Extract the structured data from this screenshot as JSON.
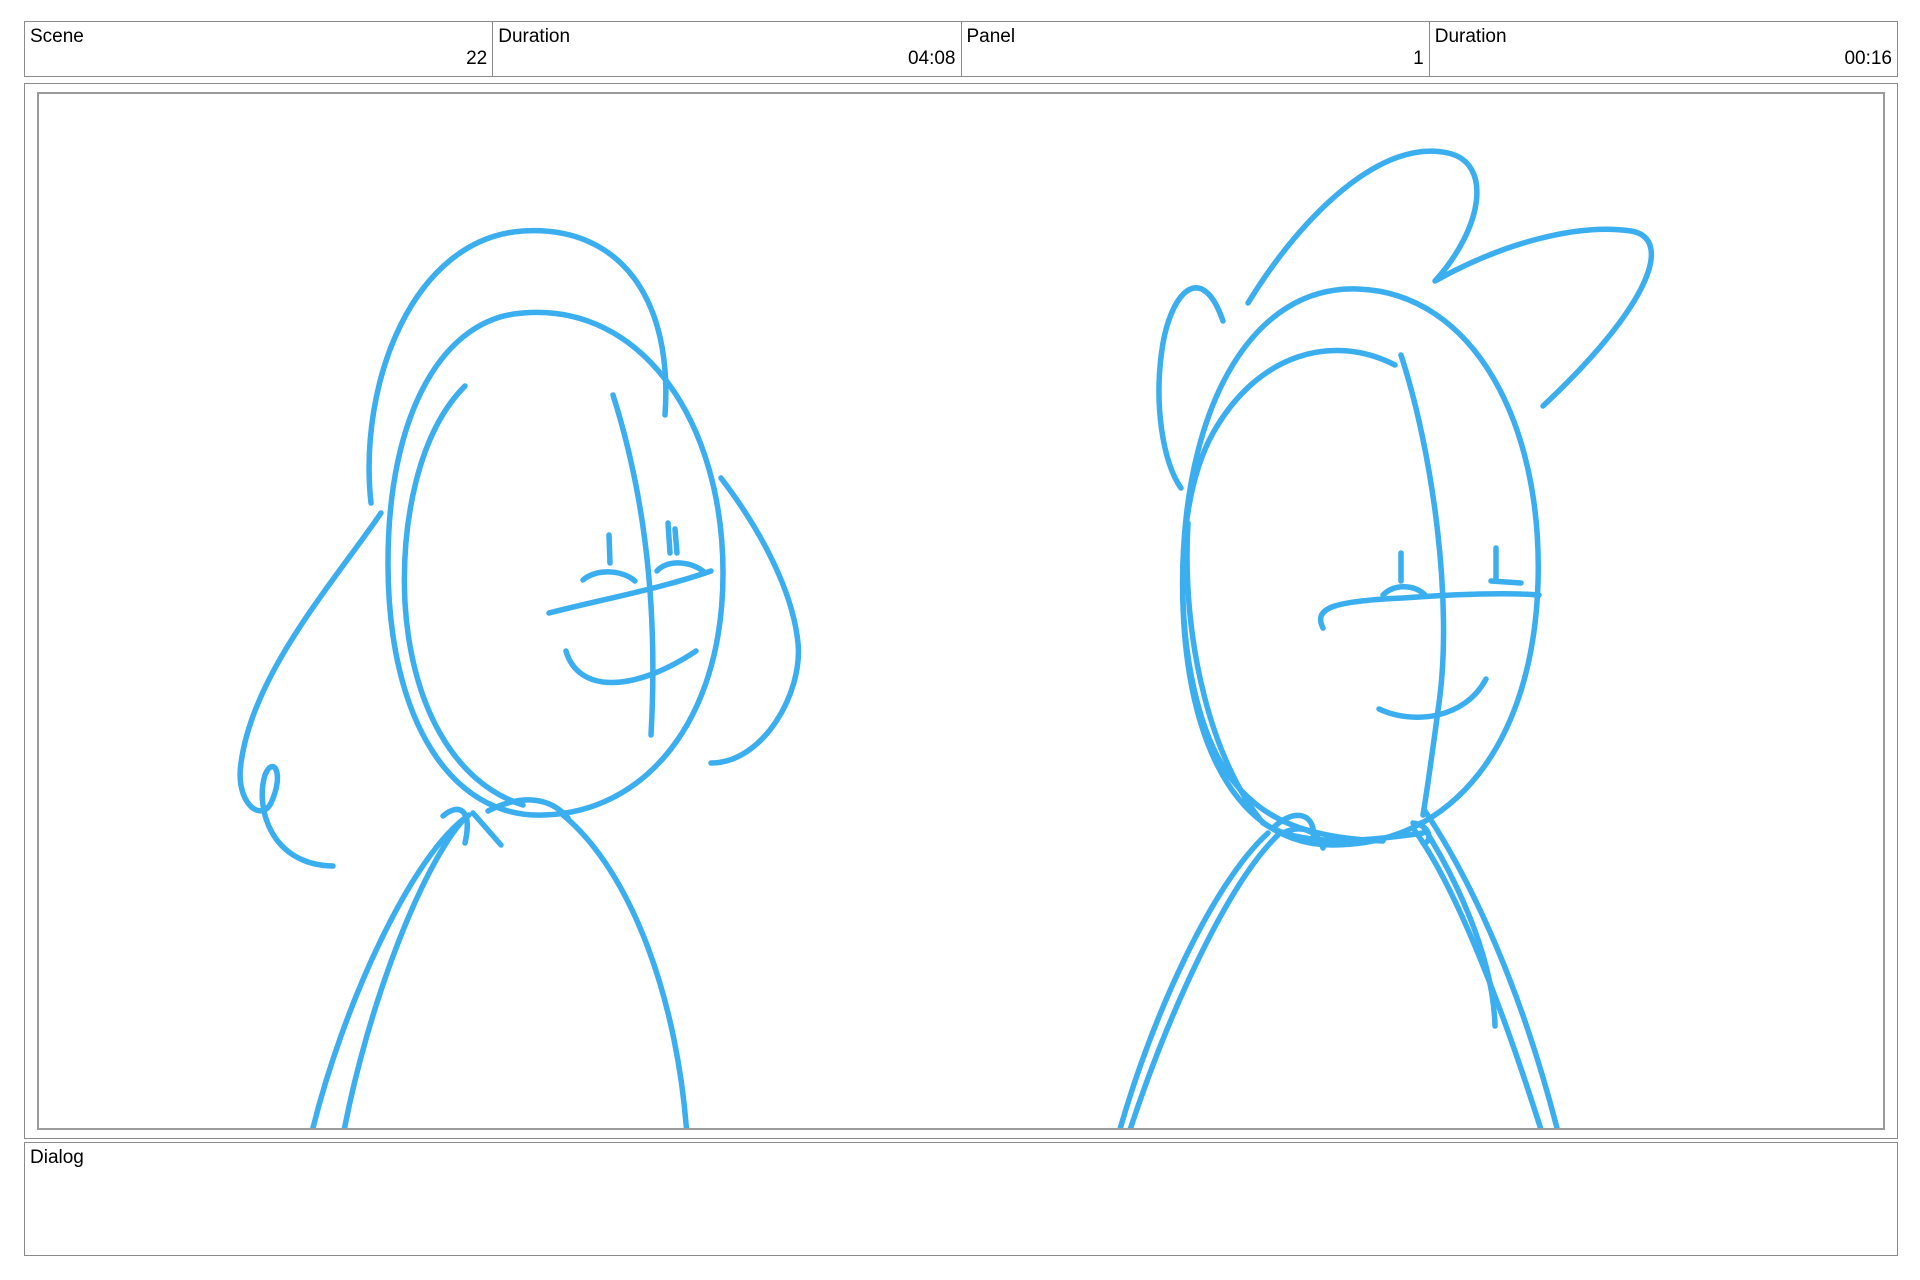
{
  "header": {
    "scene_label": "Scene",
    "scene_value": "22",
    "scene_duration_label": "Duration",
    "scene_duration_value": "04:08",
    "panel_label": "Panel",
    "panel_value": "1",
    "panel_duration_label": "Duration",
    "panel_duration_value": "00:16"
  },
  "sketch": {
    "stroke_color": "#3aaeee"
  },
  "dialog": {
    "label": "Dialog",
    "text": ""
  }
}
